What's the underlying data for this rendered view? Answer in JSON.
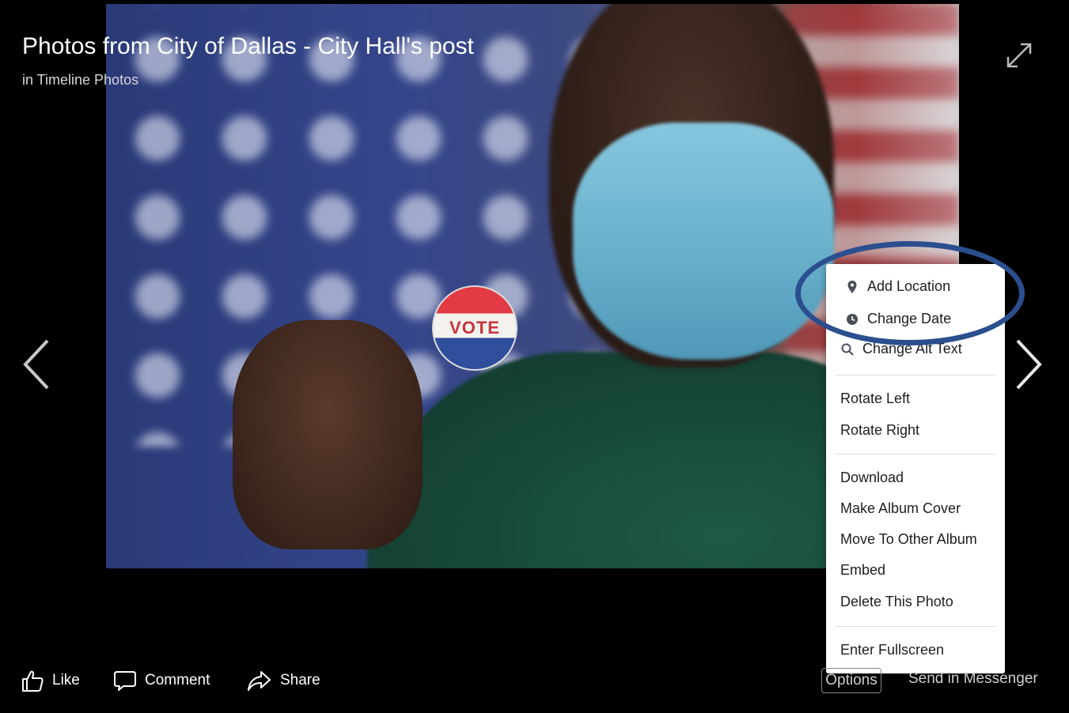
{
  "header": {
    "title": "Photos from City of Dallas - City Hall's post",
    "subtitle": "in Timeline Photos"
  },
  "photo": {
    "sticker_text": "VOTE"
  },
  "menu": {
    "items": [
      {
        "label": "Add Location",
        "icon": "location-pin-icon"
      },
      {
        "label": "Change Date",
        "icon": "clock-icon"
      },
      {
        "label": "Change Alt Text",
        "icon": "search-icon"
      },
      {
        "label": "Rotate Left"
      },
      {
        "label": "Rotate Right"
      },
      {
        "label": "Download"
      },
      {
        "label": "Make Album Cover"
      },
      {
        "label": "Move To Other Album"
      },
      {
        "label": "Embed"
      },
      {
        "label": "Delete This Photo"
      },
      {
        "label": "Enter Fullscreen"
      }
    ]
  },
  "actions": {
    "like": "Like",
    "comment": "Comment",
    "share": "Share",
    "options": "Options",
    "messenger": "Send in Messenger"
  },
  "colors": {
    "highlight": "#2b4f8e",
    "menu_bg": "#ffffff",
    "background": "#000000"
  }
}
